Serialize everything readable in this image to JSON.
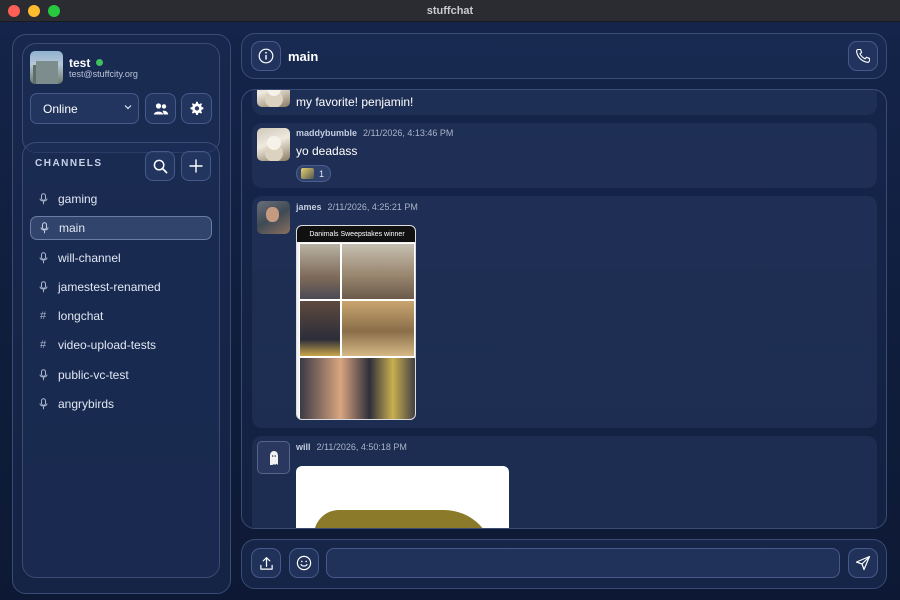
{
  "window": {
    "title": "stuffchat"
  },
  "profile": {
    "username": "test",
    "email": "test@stuffcity.org",
    "status": "Online",
    "status_color": "#3fbf5f"
  },
  "sidebar": {
    "channels_header": "CHANNELS",
    "channels": [
      {
        "name": "gaming",
        "type": "voice",
        "icon": "microphone-icon"
      },
      {
        "name": "main",
        "type": "voice",
        "icon": "microphone-icon",
        "active": true
      },
      {
        "name": "will-channel",
        "type": "voice",
        "icon": "microphone-icon"
      },
      {
        "name": "jamestest-renamed",
        "type": "voice",
        "icon": "microphone-icon"
      },
      {
        "name": "longchat",
        "type": "text",
        "icon": "hash-icon",
        "symbol": "#"
      },
      {
        "name": "video-upload-tests",
        "type": "text",
        "icon": "hash-icon",
        "symbol": "#"
      },
      {
        "name": "public-vc-test",
        "type": "voice",
        "icon": "microphone-icon"
      },
      {
        "name": "angrybirds",
        "type": "voice",
        "icon": "microphone-icon"
      }
    ]
  },
  "header": {
    "channel_title": "main"
  },
  "messages": [
    {
      "text": "my favorite! penjamin!"
    },
    {
      "author": "maddybumble",
      "time": "2/11/2026, 4:13:46 PM",
      "text": "yo deadass",
      "reaction_count": "1"
    },
    {
      "author": "james",
      "time": "2/11/2026, 4:25:21 PM",
      "attachment_caption": "Danimals Sweepstakes winner"
    },
    {
      "author": "will",
      "time": "2/11/2026, 4:50:18 PM"
    }
  ],
  "composer": {
    "value": ""
  },
  "colors": {
    "accent": "#3a4c76",
    "background": "#0f1d3c",
    "online": "#3fbf5f"
  }
}
